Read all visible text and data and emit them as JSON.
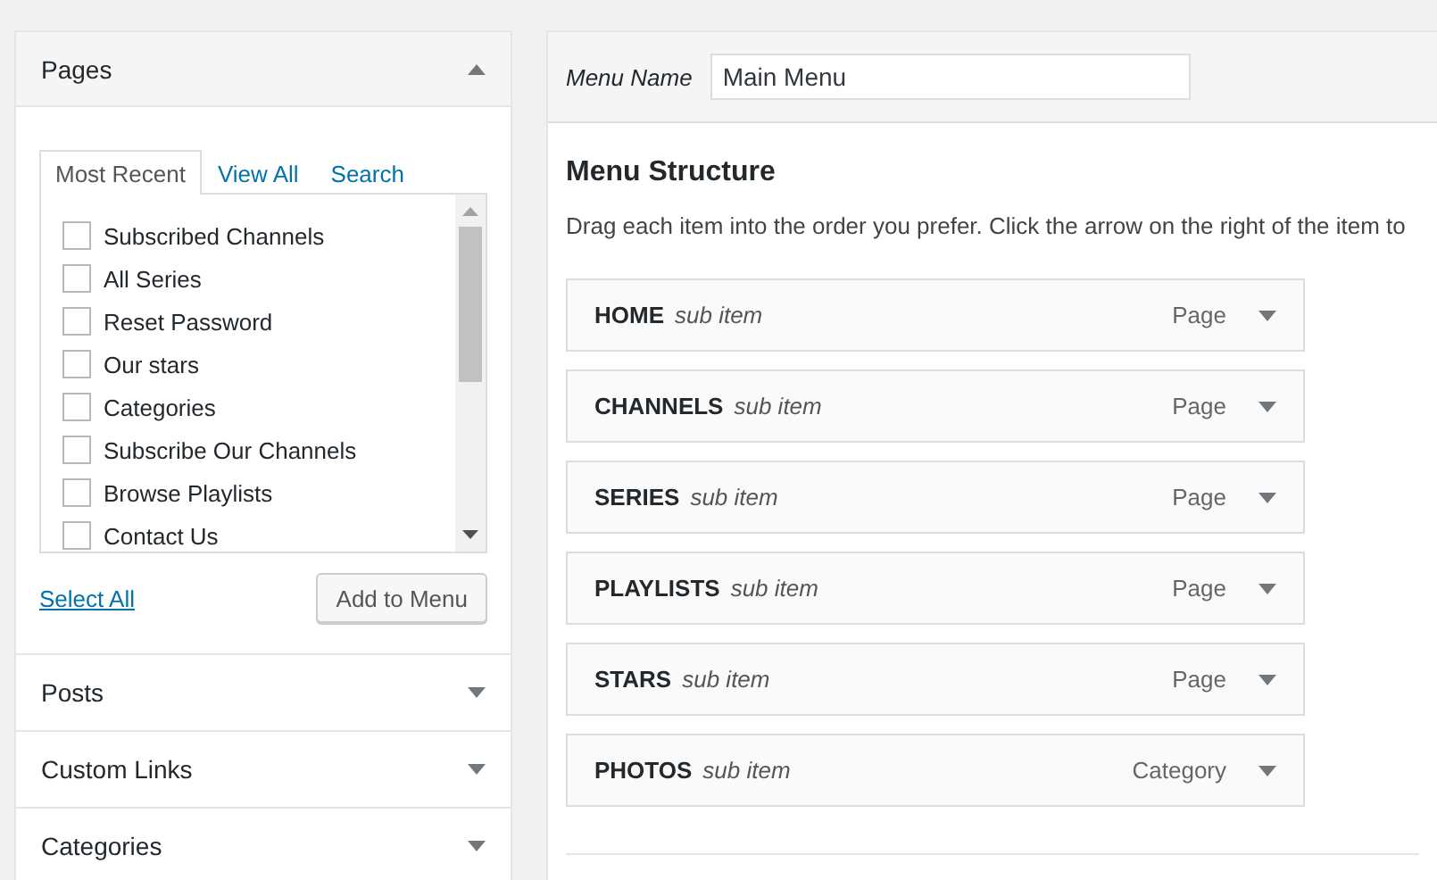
{
  "sidebar": {
    "sections": [
      {
        "title": "Pages",
        "expanded": true,
        "tabs": [
          {
            "label": "Most Recent",
            "selected": true
          },
          {
            "label": "View All",
            "selected": false
          },
          {
            "label": "Search",
            "selected": false
          }
        ],
        "items": [
          {
            "label": "Subscribed Channels",
            "checked": false
          },
          {
            "label": "All Series",
            "checked": false
          },
          {
            "label": "Reset Password",
            "checked": false
          },
          {
            "label": "Our stars",
            "checked": false
          },
          {
            "label": "Categories",
            "checked": false
          },
          {
            "label": "Subscribe Our Channels",
            "checked": false
          },
          {
            "label": "Browse Playlists",
            "checked": false
          },
          {
            "label": "Contact Us",
            "checked": false
          }
        ],
        "select_all": "Select All",
        "add_button": "Add to Menu"
      },
      {
        "title": "Posts",
        "expanded": false
      },
      {
        "title": "Custom Links",
        "expanded": false
      },
      {
        "title": "Categories",
        "expanded": false
      }
    ]
  },
  "menu_editor": {
    "name_label": "Menu Name",
    "name_value": "Main Menu",
    "heading": "Menu Structure",
    "instructions": "Drag each item into the order you prefer. Click the arrow on the right of the item to",
    "items": [
      {
        "title": "HOME",
        "subtitle": "sub item",
        "type": "Page"
      },
      {
        "title": "CHANNELS",
        "subtitle": "sub item",
        "type": "Page"
      },
      {
        "title": "SERIES",
        "subtitle": "sub item",
        "type": "Page"
      },
      {
        "title": "PLAYLISTS",
        "subtitle": "sub item",
        "type": "Page"
      },
      {
        "title": "STARS",
        "subtitle": "sub item",
        "type": "Page"
      },
      {
        "title": "PHOTOS",
        "subtitle": "sub item",
        "type": "Category"
      }
    ]
  }
}
